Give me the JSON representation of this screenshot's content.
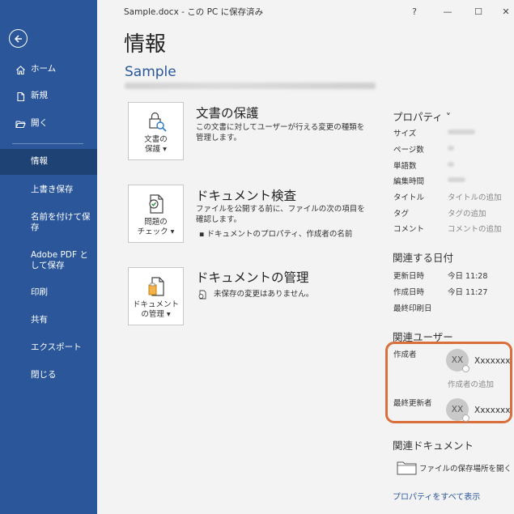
{
  "window": {
    "title": "Sample.docx  -  この PC に保存済み",
    "help": "?",
    "minimize": "—",
    "maximize": "☐",
    "close": "✕"
  },
  "sidebar": {
    "items": [
      {
        "label": "ホーム",
        "icon": "home-icon"
      },
      {
        "label": "新規",
        "icon": "new-document-icon"
      },
      {
        "label": "開く",
        "icon": "open-folder-icon"
      },
      {
        "label": "情報"
      },
      {
        "label": "上書き保存"
      },
      {
        "label": "名前を付けて保存"
      },
      {
        "label": "Adobe PDF として保存"
      },
      {
        "label": "印刷"
      },
      {
        "label": "共有"
      },
      {
        "label": "エクスポート"
      },
      {
        "label": "閉じる"
      }
    ]
  },
  "main": {
    "page_title": "情報",
    "doc_name": "Sample",
    "sections": [
      {
        "button_label": "文書の\n保護 ▾",
        "title": "文書の保護",
        "desc": "この文書に対してユーザーが行える変更の種類を管理します。",
        "icon": "lock-key-icon"
      },
      {
        "button_label": "問題の\nチェック ▾",
        "title": "ドキュメント検査",
        "desc": "ファイルを公開する前に、ファイルの次の項目を確認します。",
        "bullet": "▪  ドキュメントのプロパティ、作成者の名前",
        "icon": "inspect-document-icon"
      },
      {
        "button_label": "ドキュメント\nの管理 ▾",
        "title": "ドキュメントの管理",
        "desc": "未保存の変更はありません。",
        "icon": "manage-document-icon"
      }
    ]
  },
  "properties": {
    "heading": "プロパティ ˅",
    "rows": [
      {
        "label": "サイズ"
      },
      {
        "label": "ページ数"
      },
      {
        "label": "単語数"
      },
      {
        "label": "編集時間"
      },
      {
        "label": "タイトル",
        "value": "タイトルの追加"
      },
      {
        "label": "タグ",
        "value": "タグの追加"
      },
      {
        "label": "コメント",
        "value": "コメントの追加"
      }
    ],
    "dates_heading": "関連する日付",
    "dates": [
      {
        "label": "更新日時",
        "value": "今日 11:28"
      },
      {
        "label": "作成日時",
        "value": "今日 11:27"
      },
      {
        "label": "最終印刷日",
        "value": ""
      }
    ],
    "people_heading": "関連ユーザー",
    "author_label": "作成者",
    "author_initials": "XX",
    "author_name": "Xxxxxxxx X",
    "add_author": "作成者の追加",
    "last_modified_label": "最終更新者",
    "modifier_initials": "XX",
    "modifier_name": "Xxxxxxxx X",
    "related_docs_heading": "関連ドキュメント",
    "open_location": "ファイルの保存場所を開く",
    "show_all": "プロパティをすべて表示"
  },
  "colors": {
    "sidebar": "#2b579a",
    "sidebar_active": "#1e4273",
    "highlight_box": "#d9703b",
    "link": "#2b579a"
  }
}
